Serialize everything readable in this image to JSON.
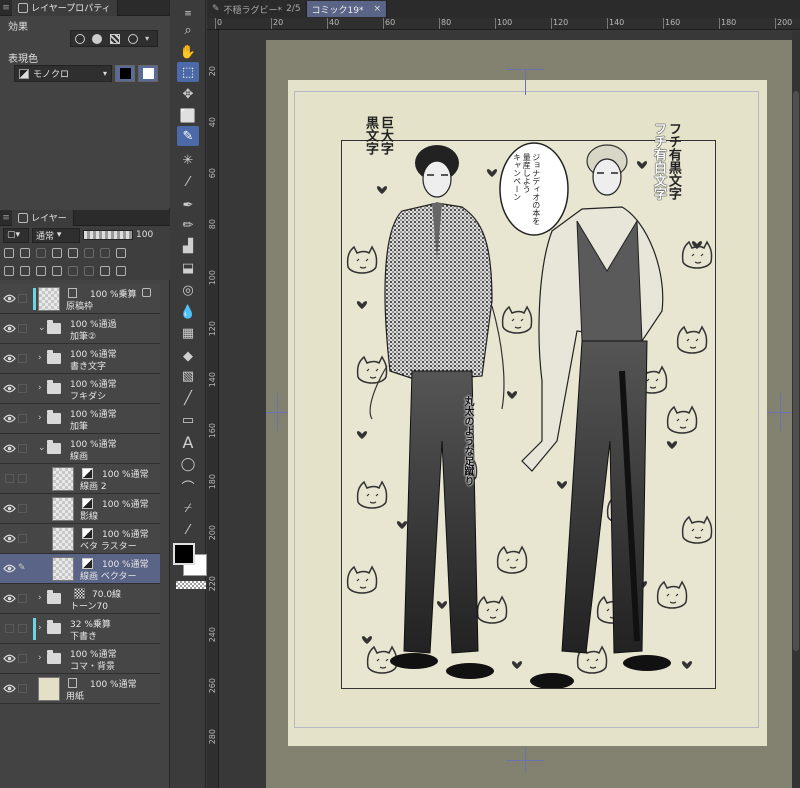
{
  "layer_property_panel": {
    "tab_label": "レイヤープロパティ",
    "effect_label": "効果",
    "expression_color_label": "表現色",
    "expression_color_value": "モノクロ"
  },
  "layer_panel": {
    "tab_label": "レイヤー",
    "blend_mode": "通常",
    "opacity": "100",
    "layers": [
      {
        "line1": "100 %乗算",
        "line2": "原稿枠",
        "type": "raster",
        "visible": true,
        "color_tag": true
      },
      {
        "line1": "100 %通過",
        "line2": "加筆②",
        "type": "folder",
        "visible": true,
        "expanded": true
      },
      {
        "line1": "100 %通常",
        "line2": "書き文字",
        "type": "folder",
        "visible": true
      },
      {
        "line1": "100 %通常",
        "line2": "フキダシ",
        "type": "folder",
        "visible": true
      },
      {
        "line1": "100 %通常",
        "line2": "加筆",
        "type": "folder",
        "visible": true
      },
      {
        "line1": "100 %通常",
        "line2": "線画",
        "type": "folder",
        "visible": true,
        "expanded": true
      },
      {
        "line1": "100 %通常",
        "line2": "線画 2",
        "type": "raster",
        "visible": false,
        "indent": true
      },
      {
        "line1": "100 %通常",
        "line2": "影線",
        "type": "raster",
        "visible": true,
        "indent": true
      },
      {
        "line1": "100 %通常",
        "line2": "ベタ ラスター",
        "type": "raster",
        "visible": true,
        "indent": true
      },
      {
        "line1": "100 %通常",
        "line2": "線画 ベクター",
        "type": "vector",
        "visible": true,
        "indent": true,
        "selected": true
      },
      {
        "line1": "70.0線",
        "line2": "トーン70",
        "type": "tone",
        "visible": true
      },
      {
        "line1": "32 %乗算",
        "line2": "下書き",
        "type": "folder",
        "visible": false,
        "color_tag": true
      },
      {
        "line1": "100 %通常",
        "line2": "コマ・背景",
        "type": "folder",
        "visible": true
      },
      {
        "line1": "100 %通常",
        "line2": "用紙",
        "type": "paper",
        "visible": true
      }
    ]
  },
  "document_tabs": [
    {
      "title": "不穏ラグビー*",
      "page": "2/5",
      "active": false
    },
    {
      "title": "コミック19*",
      "page": "",
      "active": true
    }
  ],
  "rulers": {
    "top": [
      "0",
      "20",
      "40",
      "60",
      "80",
      "100",
      "120",
      "140",
      "160",
      "180",
      "200"
    ],
    "left": [
      "20",
      "40",
      "60",
      "80",
      "100",
      "120",
      "140",
      "160",
      "180",
      "200",
      "220",
      "240",
      "260",
      "280"
    ]
  },
  "artwork": {
    "speech_bubble_lines": [
      "ジョナディオの本を",
      "量産しよう",
      "キャンペーン"
    ],
    "left_caption": [
      "巨大字",
      "黒文字"
    ],
    "right_caption": [
      "フチ有黒文字",
      "フチ有白文字"
    ],
    "middle_caption": "丸太のような足蹴り"
  },
  "colors": {
    "accent": "#5a6486",
    "paper": "#e5e2ca",
    "canvas_back": "#838170",
    "crop_mark": "#6b72b0",
    "main_color": "#000000",
    "sub_color": "#ffffff"
  }
}
